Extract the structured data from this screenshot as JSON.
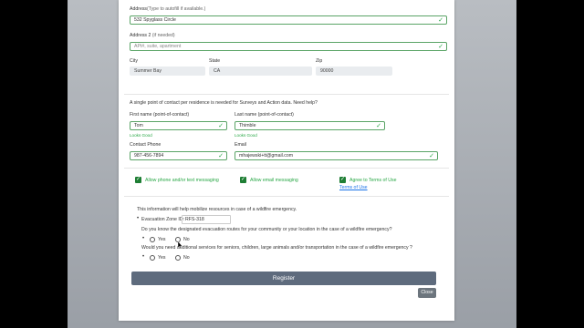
{
  "address": {
    "label": "Address",
    "hint": "(Type to autofill if available.)",
    "value": "532 Spyglass Circle"
  },
  "address2": {
    "label": "Address 2",
    "hint": "(if needed)",
    "placeholder": "APt#, suite, apartment"
  },
  "city": {
    "label": "City",
    "value": "Summer Bay"
  },
  "state": {
    "label": "State",
    "value": "CA"
  },
  "zip": {
    "label": "Zip",
    "value": "90000"
  },
  "contact_note": "A single point of contact per residence is needed for Surveys and Action data. Need help?",
  "first_name": {
    "label": "First name (point-of-contact)",
    "value": "Tom",
    "feedback": "Looks Good"
  },
  "last_name": {
    "label": "Last name (point-of-contact)",
    "value": "Thimble",
    "feedback": "Looks Good"
  },
  "phone": {
    "label": "Contact Phone",
    "value": "987-456-7894"
  },
  "email": {
    "label": "Email",
    "value": "mhajewski+tt@gmail.com"
  },
  "consents": {
    "phone_text": "Allow phone and/or text messaging",
    "email": "Allow email messaging",
    "terms": "Agree to Terms of Use",
    "terms_link": "Terms of Use"
  },
  "emergency": {
    "intro": "This information will help mobilize resources in case of a wildfire emergency.",
    "zone_label": "Evacuation Zone ID:",
    "zone_value": "RFS-318",
    "q1": "Do you know the designated evacuation routes for your community or your location in the case of a wildfire emergency?",
    "q2": "Would you need additional services for seniors, children, large animals and/or transportation in the case of a wildfire emergency ?",
    "yes": "Yes",
    "no": "No"
  },
  "buttons": {
    "register": "Register",
    "close": "Close"
  },
  "colors": {
    "valid_green": "#28a745",
    "register_bg": "#5e6b7d",
    "close_bg": "#6c757d",
    "link": "#1a73e8"
  },
  "icons": {
    "valid": "check-icon",
    "checkbox": "checkmark-icon",
    "cursor": "mouse-pointer-icon"
  }
}
